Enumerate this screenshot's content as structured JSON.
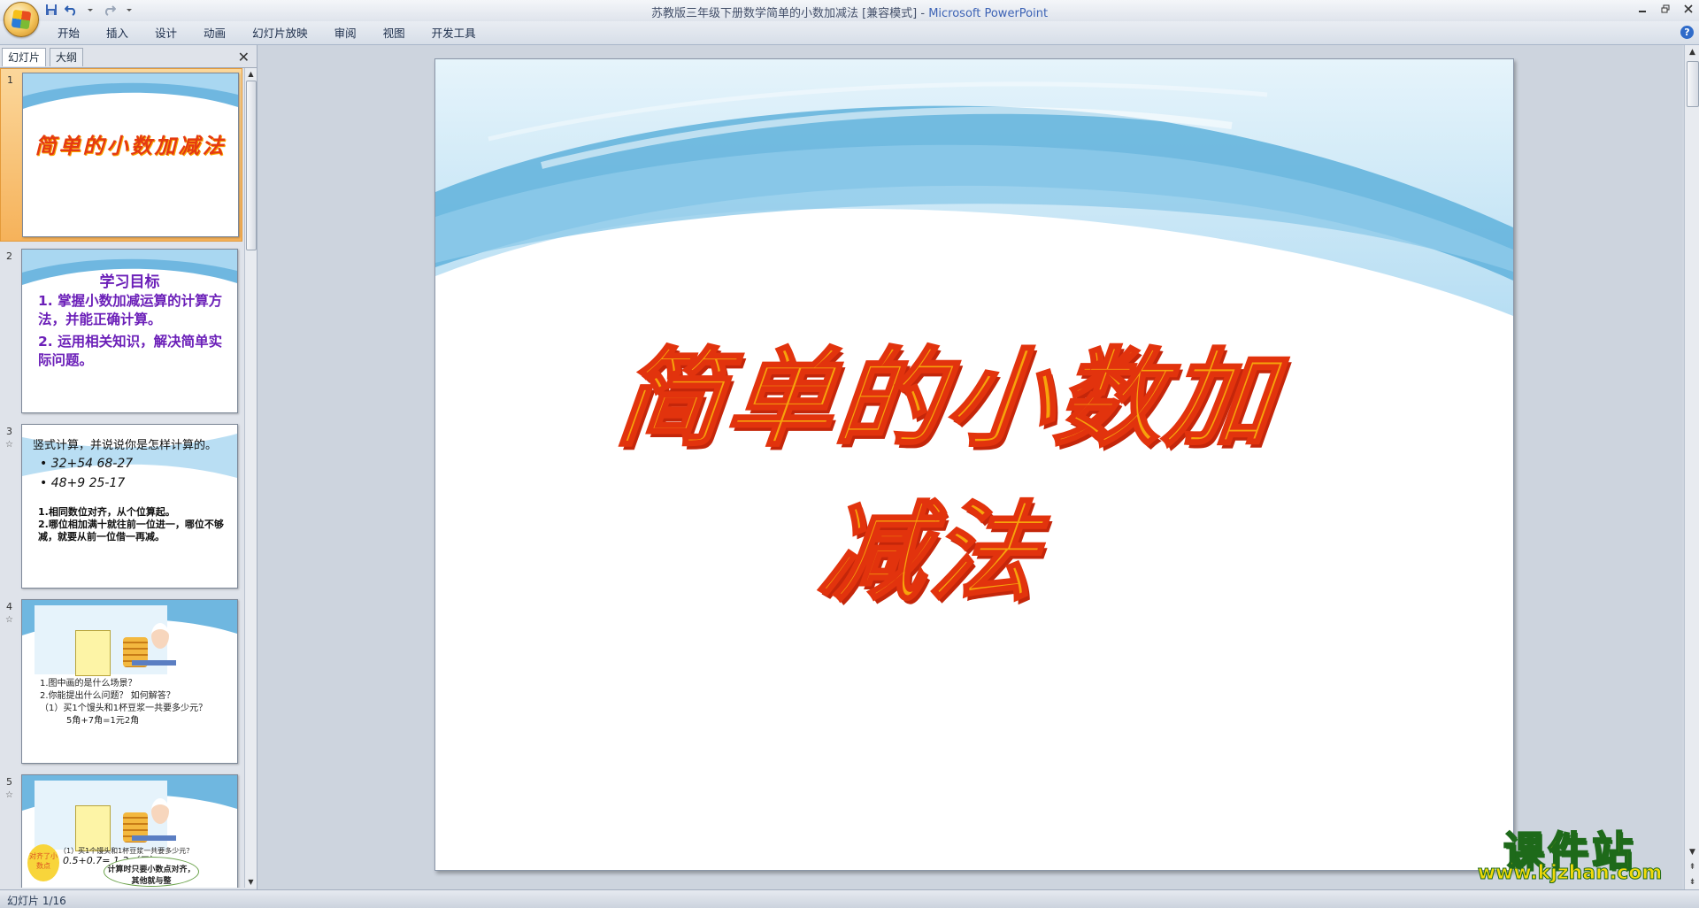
{
  "window": {
    "title": "苏教版三年级下册数学简单的小数加减法 [兼容模式]",
    "separator": " - ",
    "app_name": "Microsoft PowerPoint"
  },
  "ribbon": {
    "tabs": [
      "开始",
      "插入",
      "设计",
      "动画",
      "幻灯片放映",
      "审阅",
      "视图",
      "开发工具"
    ]
  },
  "pane": {
    "tabs": [
      "幻灯片",
      "大纲"
    ],
    "close_glyph": "✕"
  },
  "thumbnails": [
    {
      "number": "1",
      "title": "简单的小数加减法"
    },
    {
      "number": "2",
      "heading": "学习目标",
      "items": [
        "1. 掌握小数加减运算的计算方法，并能正确计算。",
        "2. 运用相关知识，解决简单实际问题。"
      ]
    },
    {
      "number": "3",
      "question": "竖式计算，并说说你是怎样计算的。",
      "calc_row1": "• 32+54        68-27",
      "calc_row2": "• 48+9         25-17",
      "notes": [
        "1.相同数位对齐，从个位算起。",
        "2.哪位相加满十就往前一位进一，哪位不够减，就要从前一位借一再减。"
      ]
    },
    {
      "number": "4",
      "lines": [
        "1.图中画的是什么场景？",
        "2.你能提出什么问题？ 如何解答？",
        "（1）买1个馒头和1杯豆浆一共要多少元？",
        "5角+7角=1元2角"
      ]
    },
    {
      "number": "5",
      "line": "（1）买1个馒头和1杯豆浆一共要多少元？",
      "equation": "0.5+0.7=  1.2（元）",
      "bubble": "对齐了小数点",
      "cloud": "计算时只要小数点对齐，其他就与整"
    }
  ],
  "slide": {
    "title": "简单的小数加减法"
  },
  "watermark": {
    "brand": "课件站",
    "url": "www.kjzhan.com"
  },
  "status": {
    "slide_counter": "幻灯片 1/16"
  }
}
